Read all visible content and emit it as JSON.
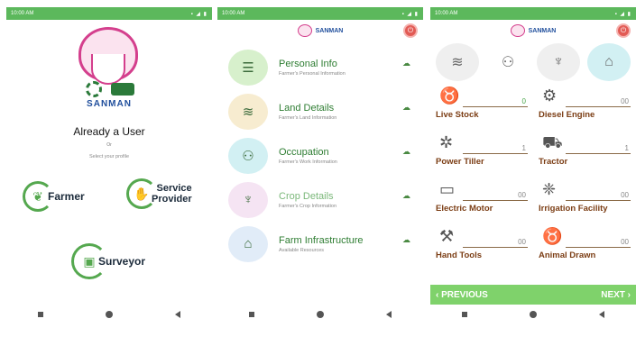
{
  "screen1": {
    "status": {
      "time": "10:00 AM",
      "icons": "▪ ◢ ▮"
    },
    "logo_text": "SANMAN",
    "already_user": "Already a User",
    "or": "Or",
    "select_profile": "Select your profile",
    "farmer": "Farmer",
    "service_provider_line1": "Service",
    "service_provider_line2": "Provider",
    "surveyor": "Surveyor"
  },
  "screen2": {
    "status": {
      "time": "10:00 AM",
      "icons": "▪ ◢ ▮"
    },
    "app_name": "SANMAN",
    "menu": [
      {
        "title": "Personal Info",
        "sub": "Farmer's Personal Information",
        "icon": "person-list-icon"
      },
      {
        "title": "Land Details",
        "sub": "Farmer's Land Information",
        "icon": "land-icon"
      },
      {
        "title": "Occupation",
        "sub": "Farmer's Work Information",
        "icon": "occupation-icon"
      },
      {
        "title": "Crop Details",
        "sub": "Farmer's Crop Information",
        "icon": "crop-icon"
      },
      {
        "title": "Farm Infrastructure",
        "sub": "Available Resources",
        "icon": "farm-infrastructure-icon"
      }
    ]
  },
  "screen3": {
    "status": {
      "time": "10:00 AM",
      "icons": "▪ ◢ ▮"
    },
    "app_name": "SANMAN",
    "items": [
      {
        "name": "Live Stock",
        "count": "0"
      },
      {
        "name": "Diesel Engine",
        "count": "00"
      },
      {
        "name": "Power Tiller",
        "count": "1"
      },
      {
        "name": "Tractor",
        "count": "1"
      },
      {
        "name": "Electric Motor",
        "count": "00"
      },
      {
        "name": "Irrigation Facility",
        "count": "00"
      },
      {
        "name": "Hand Tools",
        "count": "00"
      },
      {
        "name": "Animal Drawn",
        "count": "00"
      }
    ],
    "previous": "PREVIOUS",
    "next": "NEXT"
  }
}
